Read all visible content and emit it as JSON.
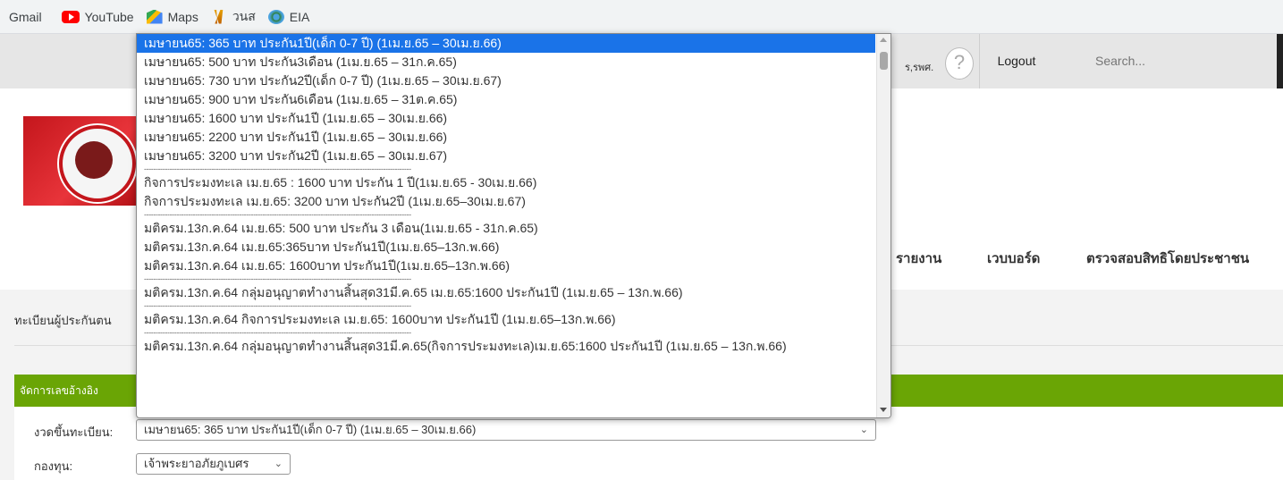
{
  "bookmarks": [
    {
      "label": "Gmail",
      "icon": "none"
    },
    {
      "label": "YouTube",
      "icon": "youtube-icon"
    },
    {
      "label": "Maps",
      "icon": "maps-icon"
    },
    {
      "label": "วนส",
      "icon": "wns-icon"
    },
    {
      "label": "EIA",
      "icon": "eia-icon"
    }
  ],
  "header": {
    "user_fragment": "ร,รพศ.",
    "logout": "Logout",
    "search_placeholder": "Search..."
  },
  "nav": {
    "report": "รายงาน",
    "webboard": "เวบบอร์ด",
    "check_rights": "ตรวจสอบสิทธิโดยประชาชน"
  },
  "breadcrumb": "ทะเบียนผู้ประกันตน",
  "section_title": "จัดการเลขอ้างอิง",
  "form": {
    "period_label": "งวดขึ้นทะเบียน:",
    "period_value": "เมษายน65: 365 บาท ประกัน1ปี(เด็ก 0-7 ปี) (1เม.ย.65 – 30เม.ย.66)",
    "fund_label": "กองทุน:",
    "fund_value": "เจ้าพระยาอภัยภูเบศร"
  },
  "dropdown": {
    "options": [
      "เมษายน65: 365 บาท ประกัน1ปี(เด็ก 0-7 ปี) (1เม.ย.65 – 30เม.ย.66)",
      "เมษายน65: 500 บาท ประกัน3เดือน (1เม.ย.65 – 31ก.ค.65)",
      "เมษายน65: 730 บาท ประกัน2ปี(เด็ก 0-7 ปี) (1เม.ย.65 – 30เม.ย.67)",
      "เมษายน65: 900 บาท ประกัน6เดือน (1เม.ย.65 – 31ต.ค.65)",
      "เมษายน65: 1600 บาท ประกัน1ปี (1เม.ย.65 – 30เม.ย.66)",
      "เมษายน65: 2200 บาท ประกัน1ปี (1เม.ย.65 – 30เม.ย.66)",
      "เมษายน65: 3200 บาท ประกัน2ปี (1เม.ย.65 – 30เม.ย.67)",
      "-------------------------------------------------------------------------------------------------------------------",
      "กิจการประมงทะเล เม.ย.65 : 1600 บาท ประกัน 1 ปี(1เม.ย.65 - 30เม.ย.66)",
      "กิจการประมงทะเล เม.ย.65: 3200 บาท ประกัน2ปี (1เม.ย.65–30เม.ย.67)",
      "-------------------------------------------------------------------------------------------------------------------",
      "มติครม.13ก.ค.64 เม.ย.65: 500 บาท ประกัน 3 เดือน(1เม.ย.65 - 31ก.ค.65)",
      "มติครม.13ก.ค.64 เม.ย.65:365บาท ประกัน1ปี(1เม.ย.65–13ก.พ.66)",
      "มติครม.13ก.ค.64 เม.ย.65: 1600บาท ประกัน1ปี(1เม.ย.65–13ก.พ.66)",
      "-------------------------------------------------------------------------------------------------------------------",
      "มติครม.13ก.ค.64 กลุ่มอนุญาตทำงานสิ้นสุด31มี.ค.65 เม.ย.65:1600 ประกัน1ปี (1เม.ย.65 – 13ก.พ.66)",
      "-------------------------------------------------------------------------------------------------------------------",
      "มติครม.13ก.ค.64 กิจการประมงทะเล เม.ย.65: 1600บาท ประกัน1ปี (1เม.ย.65–13ก.พ.66)",
      "-------------------------------------------------------------------------------------------------------------------",
      "มติครม.13ก.ค.64 กลุ่มอนุญาตทำงานสิ้นสุด31มี.ค.65(กิจการประมงทะเล)เม.ย.65:1600 ประกัน1ปี (1เม.ย.65 – 13ก.พ.66)"
    ]
  },
  "colors": {
    "accent_green": "#6aa505",
    "selected_option": "#1a73e8"
  }
}
